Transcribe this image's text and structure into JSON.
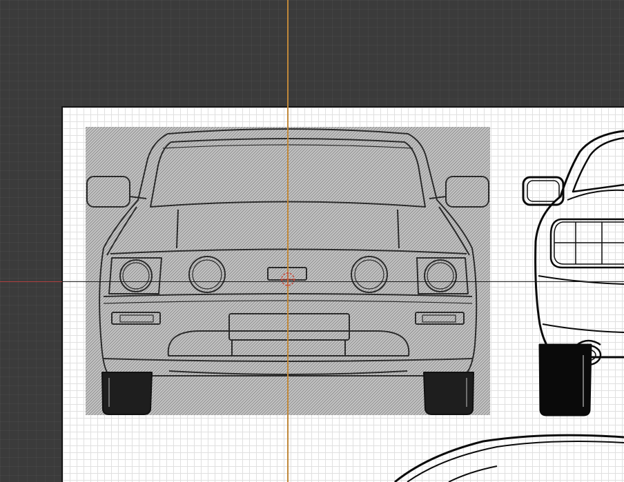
{
  "viewport": {
    "background_color": "#3b3b3b",
    "sheet_color": "#ffffff",
    "y_axis_color": "#c0883a",
    "x_axis_color": "#b04040"
  },
  "reference_images": [
    {
      "view": "front",
      "style": "hatched"
    },
    {
      "view": "rear-three-quarter",
      "style": "line-art"
    },
    {
      "view": "roof-profile",
      "style": "line-art"
    }
  ],
  "cursor": {
    "icon": "3d-cursor-icon"
  }
}
